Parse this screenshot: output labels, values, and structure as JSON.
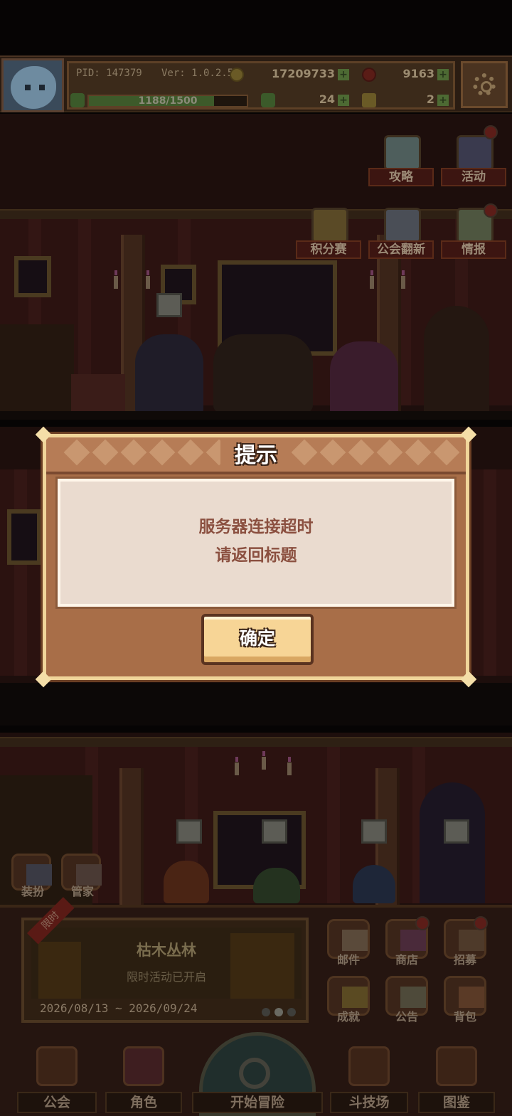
{
  "hud": {
    "pid": "PID: 147379",
    "version": "Ver: 1.0.2.5",
    "gold": "17209733",
    "gems": "9163",
    "energy": "1188/1500",
    "energy_fraction": 0.792,
    "clover": "24",
    "keys": "2",
    "settings_icon": "gear-icon"
  },
  "side_buttons": [
    {
      "label": "攻略",
      "icon": "chat-guide-icon"
    },
    {
      "label": "活动",
      "icon": "balloons-icon"
    },
    {
      "label": "积分赛",
      "icon": "trophy-icon"
    },
    {
      "label": "公会翻新",
      "icon": "renovate-icon"
    },
    {
      "label": "情报",
      "icon": "intel-map-icon"
    }
  ],
  "room_buttons": [
    {
      "label": "装扮",
      "icon": "dressup-icon"
    },
    {
      "label": "管家",
      "icon": "butler-icon"
    }
  ],
  "event": {
    "tag": "限时",
    "title": "枯木丛林",
    "subtitle": "限时活动已开启",
    "dates": "2026/08/13 ~ 2026/09/24"
  },
  "grid_buttons": [
    {
      "label": "邮件",
      "icon": "mail-icon",
      "badge": true
    },
    {
      "label": "商店",
      "icon": "shop-icon",
      "badge": true
    },
    {
      "label": "招募",
      "icon": "recruit-icon",
      "badge": true
    },
    {
      "label": "成就",
      "icon": "achievement-icon",
      "badge": false
    },
    {
      "label": "公告",
      "icon": "announcement-icon",
      "badge": false
    },
    {
      "label": "背包",
      "icon": "backpack-icon",
      "badge": false
    }
  ],
  "nav": [
    {
      "label": "公会",
      "icon": "guild-icon"
    },
    {
      "label": "角色",
      "icon": "character-icon"
    },
    {
      "label": "开始冒险",
      "icon": "magnifier-icon"
    },
    {
      "label": "斗技场",
      "icon": "crossed-swords-icon"
    },
    {
      "label": "图鉴",
      "icon": "codex-icon"
    }
  ],
  "dialog": {
    "title": "提示",
    "line1": "服务器连接超时",
    "line2": "请返回标题",
    "ok_label": "确定"
  },
  "colors": {
    "dialog_body": "#eadbcf",
    "dialog_frame": "#a86e48",
    "dialog_text": "#8b5040",
    "button_fill": "#f7d596",
    "overlay_dim": "#000000"
  }
}
